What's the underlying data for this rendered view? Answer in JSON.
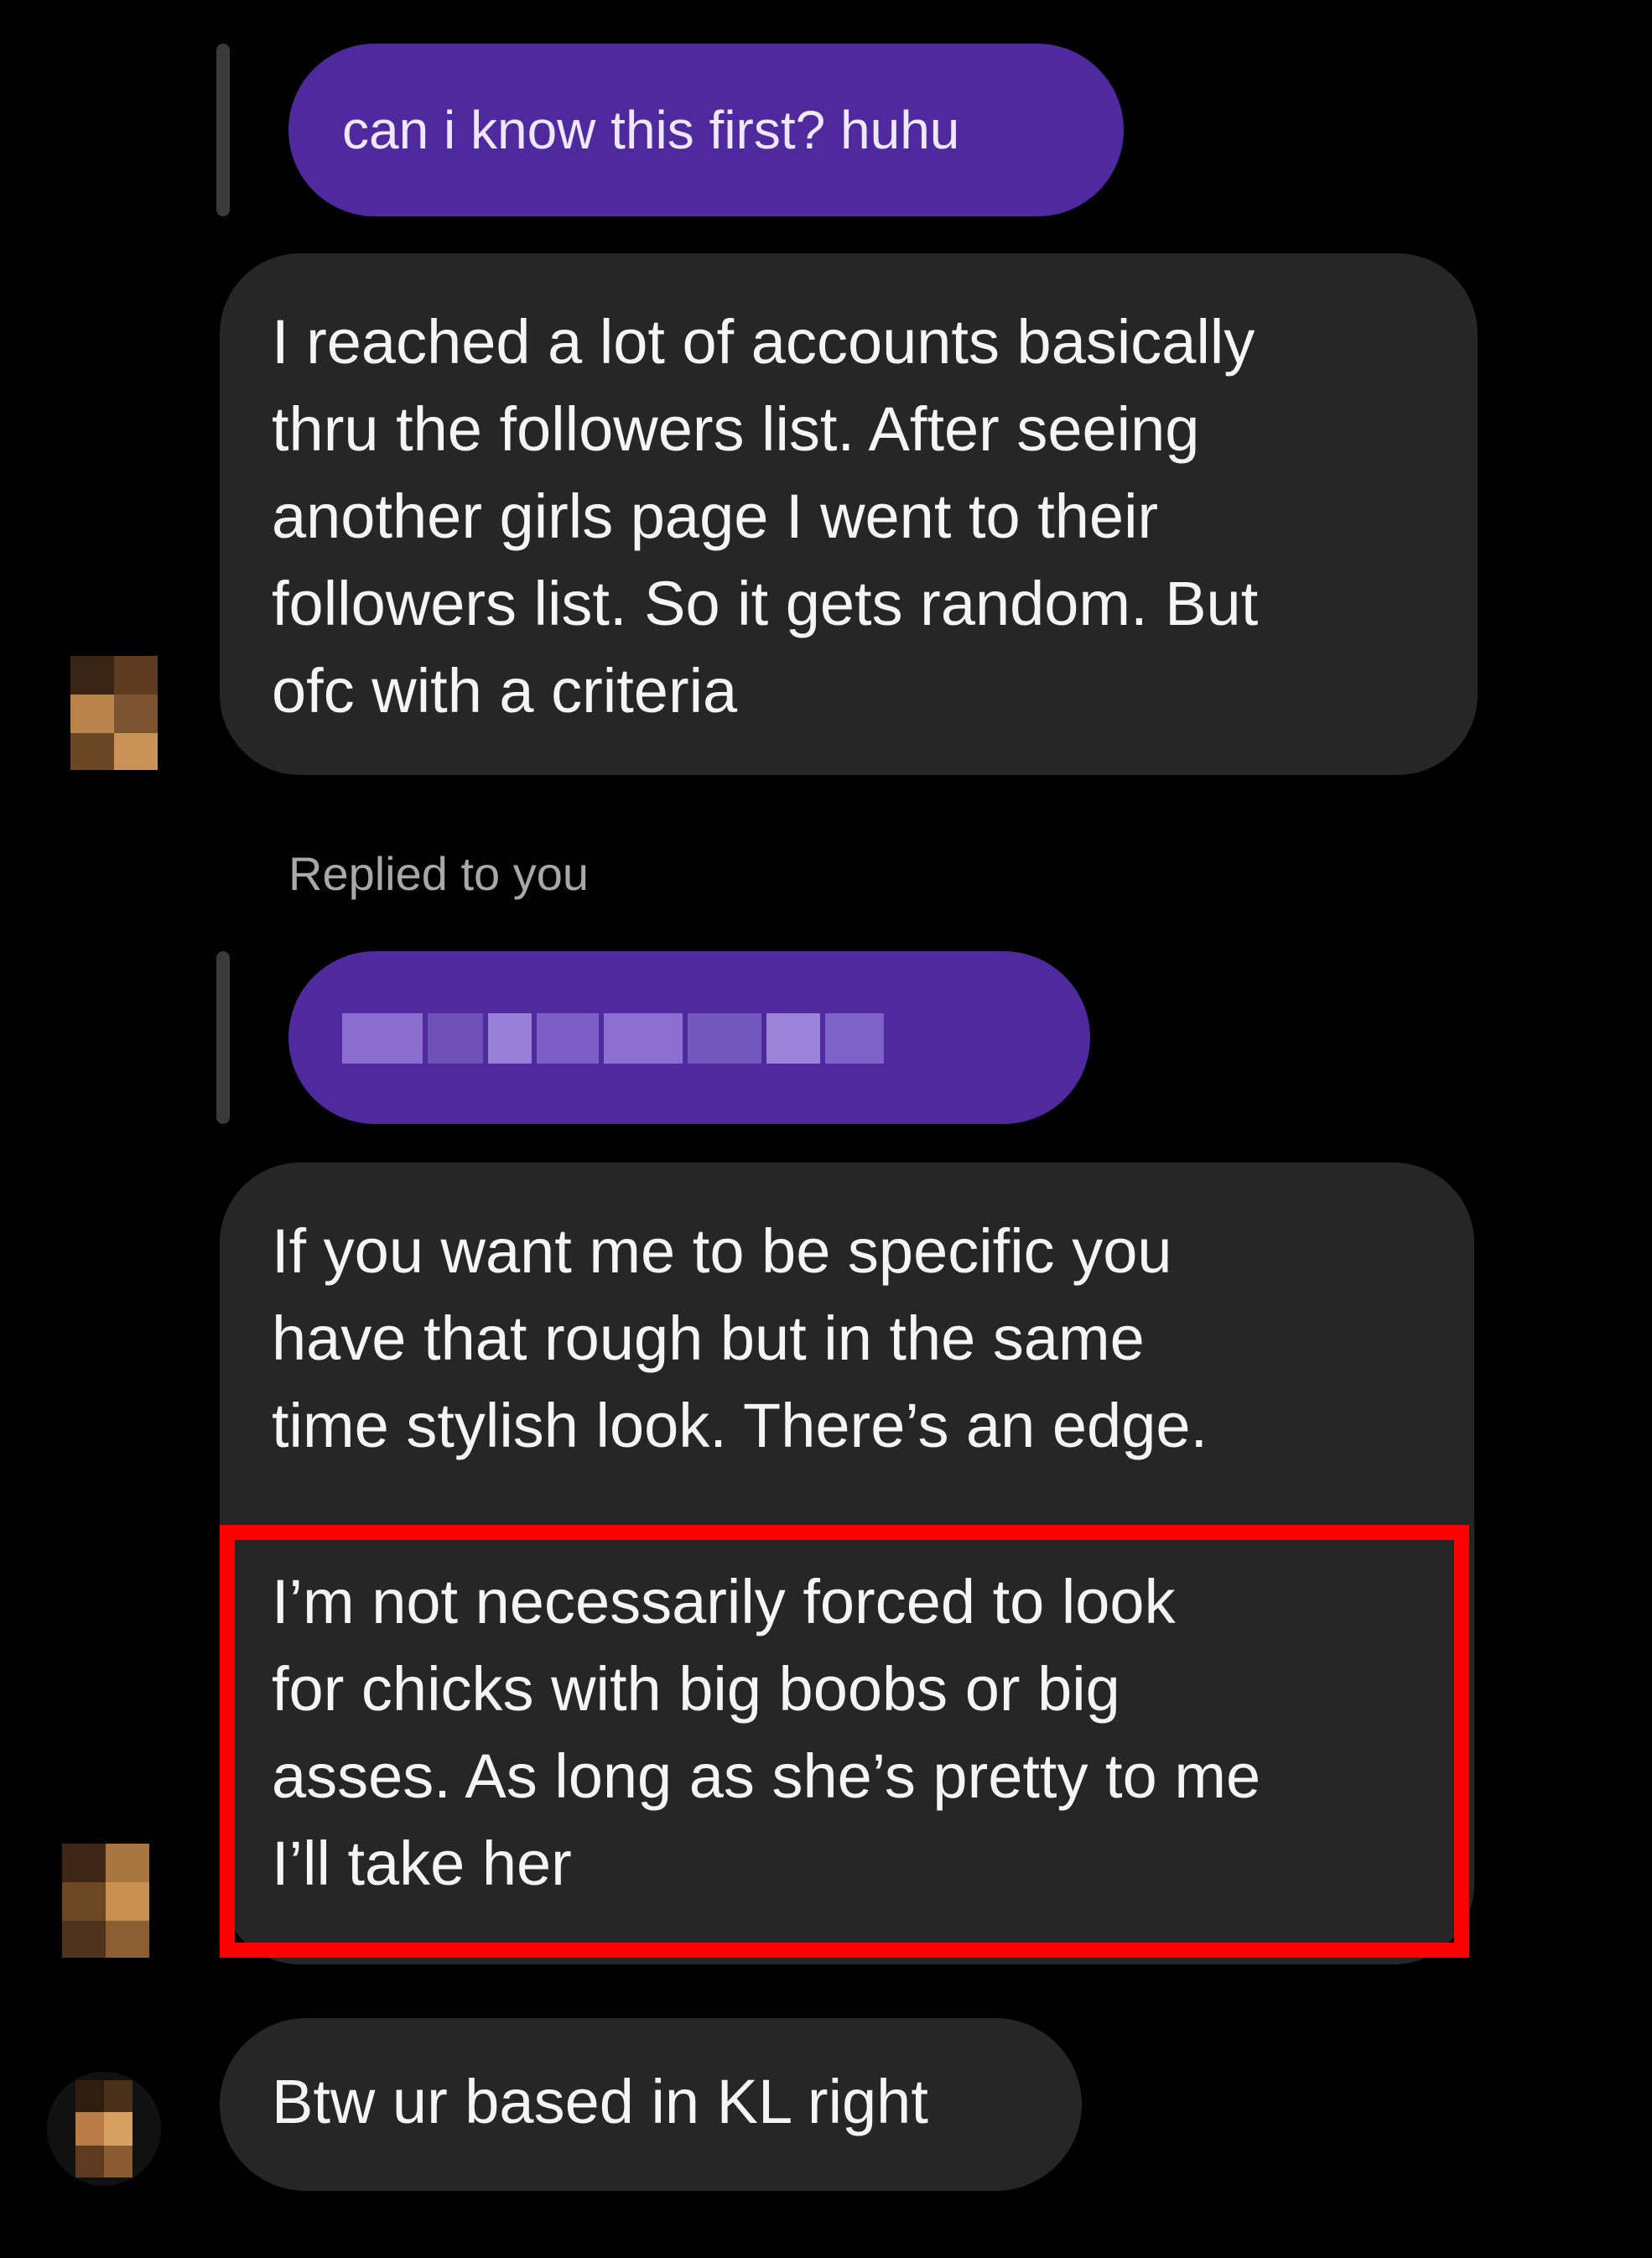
{
  "conversation": {
    "message_1": {
      "quoted_reply": "can i know this first? huhu",
      "text": "I reached a lot of accounts basically\nthru the followers list. After seeing\nanother girls page I went to their\nfollowers list. So it gets random. But\nofc with a criteria"
    },
    "message_2": {
      "replied_label": "Replied to you",
      "quoted_reply": "",
      "text_a": "If you want me to be specific you\nhave that rough but in the same\ntime stylish look. There’s an edge.",
      "text_b": "I’m not necessarily forced to look\nfor chicks with big boobs or big\nasses. As long as she’s pretty to me\nI’ll take her"
    },
    "message_3": {
      "text": "Btw ur based in KL right"
    }
  },
  "colors": {
    "background": "#000000",
    "incoming_bubble": "#262626",
    "reply_bubble": "#4e2a9e",
    "highlight": "#ff0000"
  },
  "icons": {
    "avatar": "avatar-icon"
  }
}
